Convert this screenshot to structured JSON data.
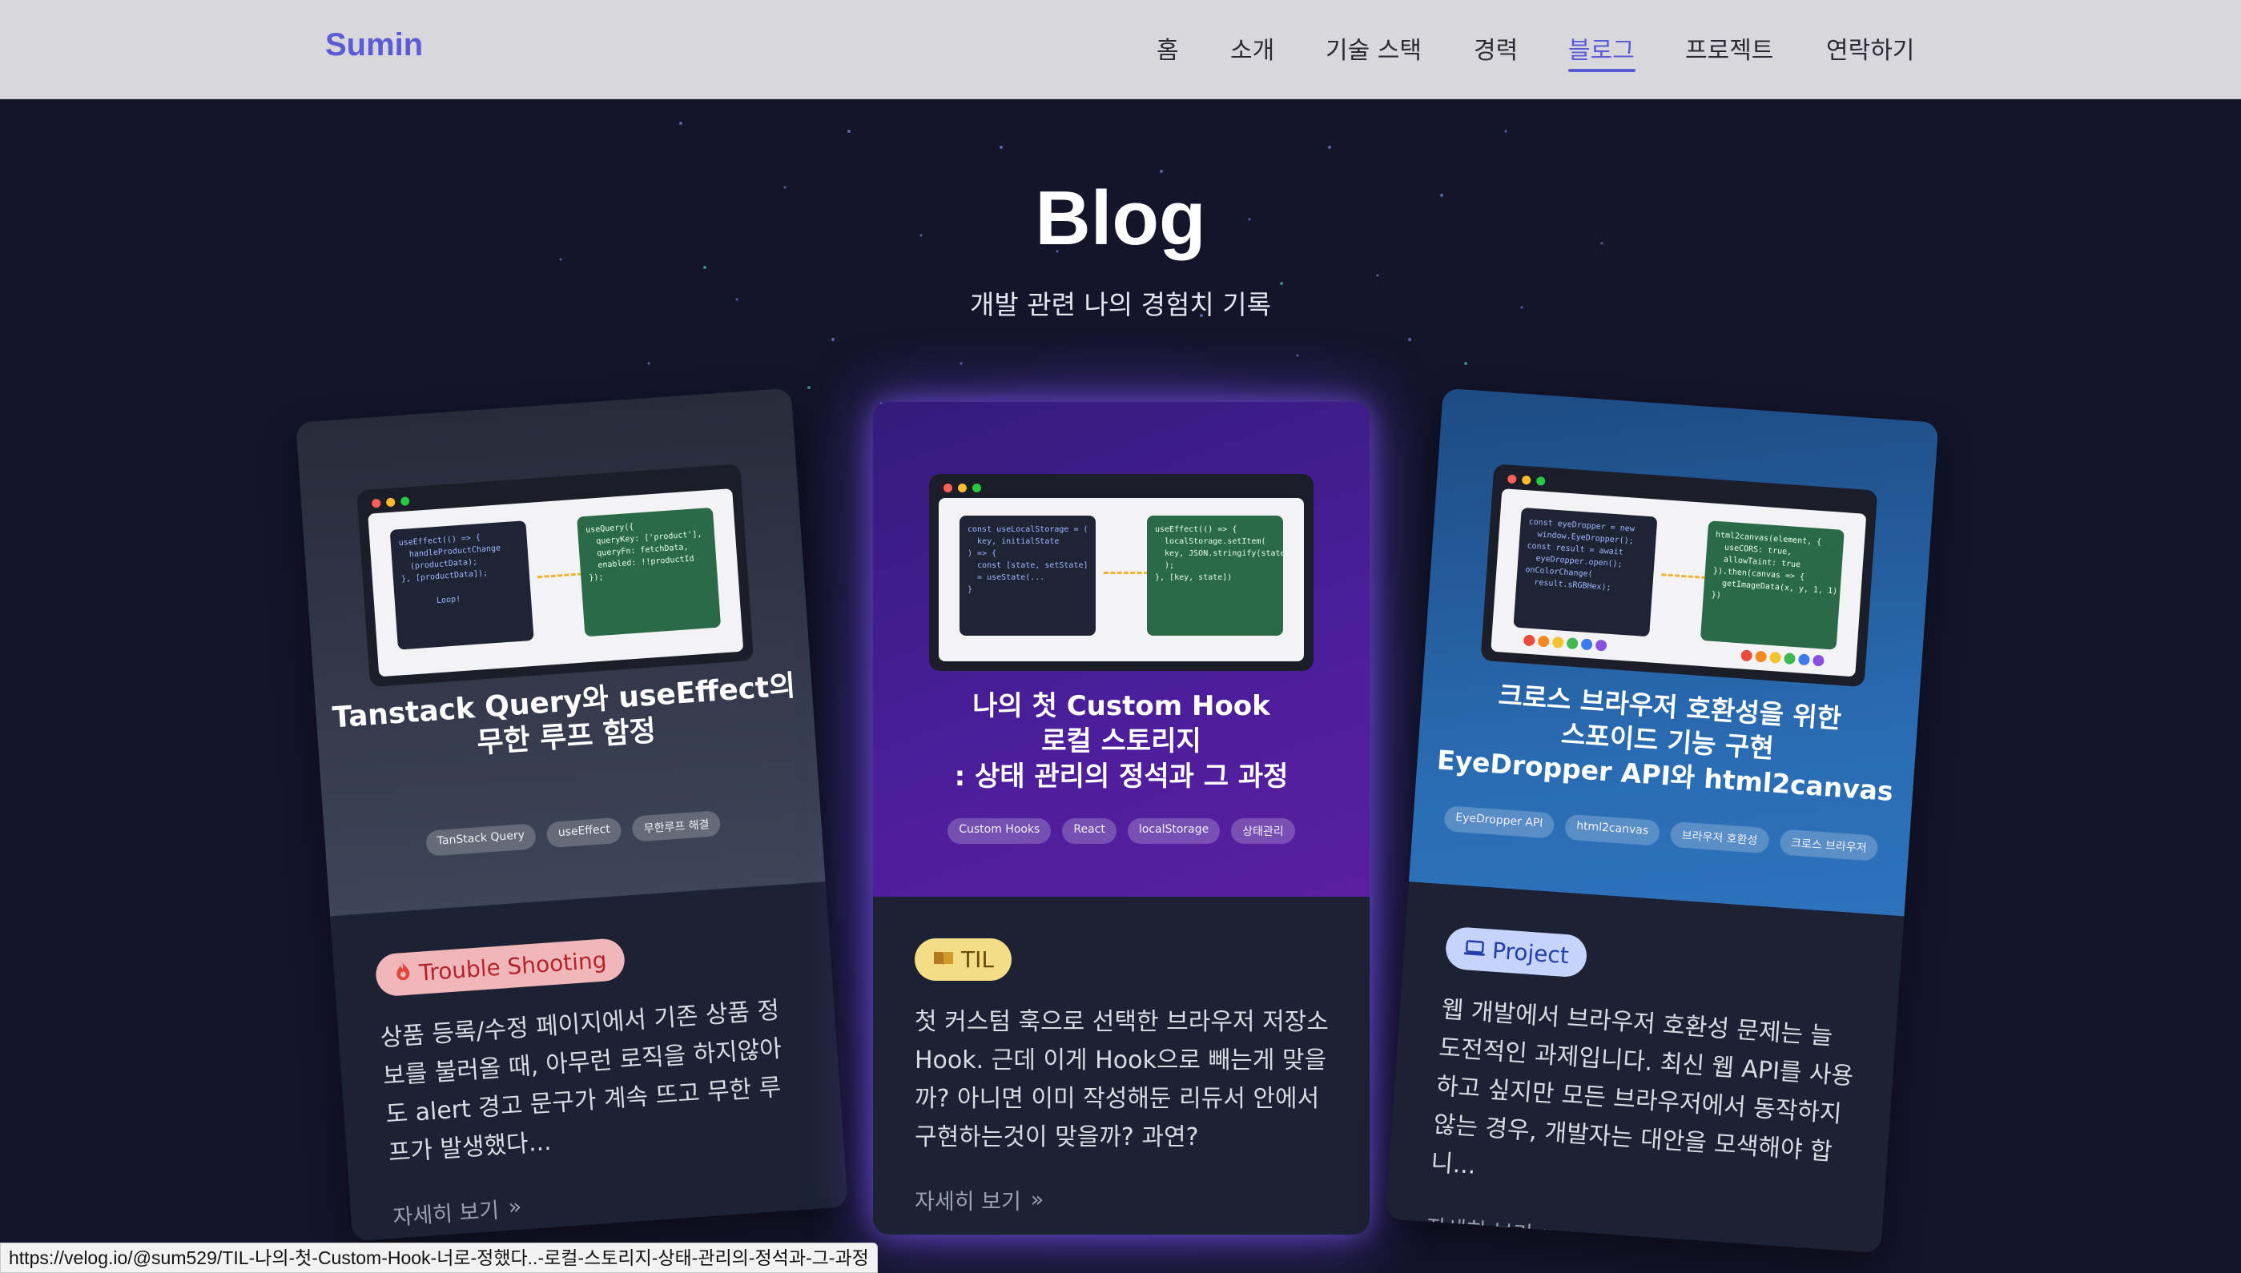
{
  "nav": {
    "logo": "Sumin",
    "items": [
      {
        "label": "홈",
        "active": false
      },
      {
        "label": "소개",
        "active": false
      },
      {
        "label": "기술 스택",
        "active": false
      },
      {
        "label": "경력",
        "active": false
      },
      {
        "label": "블로그",
        "active": true
      },
      {
        "label": "프로젝트",
        "active": false
      },
      {
        "label": "연락하기",
        "active": false
      }
    ]
  },
  "hero": {
    "title": "Blog",
    "subtitle": "개발 관련 나의 경험치 기록"
  },
  "cards": [
    {
      "title_lines": [
        "Tanstack Query와 useEffect의",
        "무한 루프 함정"
      ],
      "tags": [
        "TanStack Query",
        "useEffect",
        "무한루프 해결"
      ],
      "badge": "Trouble Shooting",
      "badge_icon": "fire-icon",
      "description": "상품 등록/수정 페이지에서 기존 상품 정보를 불러올 때, 아무런 로직을 하지않아도 alert 경고 문구가 계속 뜨고 무한 루프가 발생했다...",
      "more": "자세히 보기",
      "code_left": "useEffect(() => {\n  handleProductChange\n  (productData);\n}, [productData]);\n\n       Loop!",
      "code_right": "useQuery({\n  queryKey: ['product'],\n  queryFn: fetchData,\n  enabled: !!productId\n});"
    },
    {
      "title_lines": [
        "나의 첫 Custom Hook",
        "로컬 스토리지",
        ": 상태 관리의 정석과 그 과정"
      ],
      "tags": [
        "Custom Hooks",
        "React",
        "localStorage",
        "상태관리"
      ],
      "badge": "TIL",
      "badge_icon": "book-icon",
      "description": "첫 커스텀 훅으로 선택한 브라우저 저장소 Hook. 근데 이게 Hook으로 빼는게 맞을까? 아니면 이미 작성해둔 리듀서 안에서 구현하는것이 맞을까? 과연?",
      "more": "자세히 보기",
      "code_left": "const useLocalStorage = (\n  key, initialState\n) => {\n  const [state, setState]\n  = useState(...\n}",
      "code_right": "useEffect(() => {\n  localStorage.setItem(\n  key, JSON.stringify(state)\n  );\n}, [key, state])"
    },
    {
      "title_lines": [
        "크로스 브라우저 호환성을 위한",
        "스포이드 기능 구현",
        "EyeDropper API와 html2canvas"
      ],
      "tags": [
        "EyeDropper API",
        "html2canvas",
        "브라우저 호환성",
        "크로스 브라우저"
      ],
      "badge": "Project",
      "badge_icon": "laptop-icon",
      "description": "웹 개발에서 브라우저 호환성 문제는 늘 도전적인 과제입니다. 최신 웹 API를 사용하고 싶지만 모든 브라우저에서 동작하지 않는 경우, 개발자는 대안을 모색해야 합니...",
      "more": "자세히 보기",
      "code_left": "const eyeDropper = new\n  window.EyeDropper();\nconst result = await\n  eyeDropper.open();\nonColorChange(\n  result.sRGBHex);",
      "code_right": "html2canvas(element, {\n  useCORS: true,\n  allowTaint: true\n}).then(canvas => {\n  getImageData(x, y, 1, 1)\n})"
    }
  ],
  "status_url": "https://velog.io/@sum529/TIL-나의-첫-Custom-Hook-너로-정했다..-로컬-스토리지-상태-관리의-정석과-그-과정",
  "colors": {
    "accent": "#5b5bd6",
    "nav_bg": "#d7d7dc",
    "page_bg": "#14142b",
    "glow": "#6e46f0"
  }
}
